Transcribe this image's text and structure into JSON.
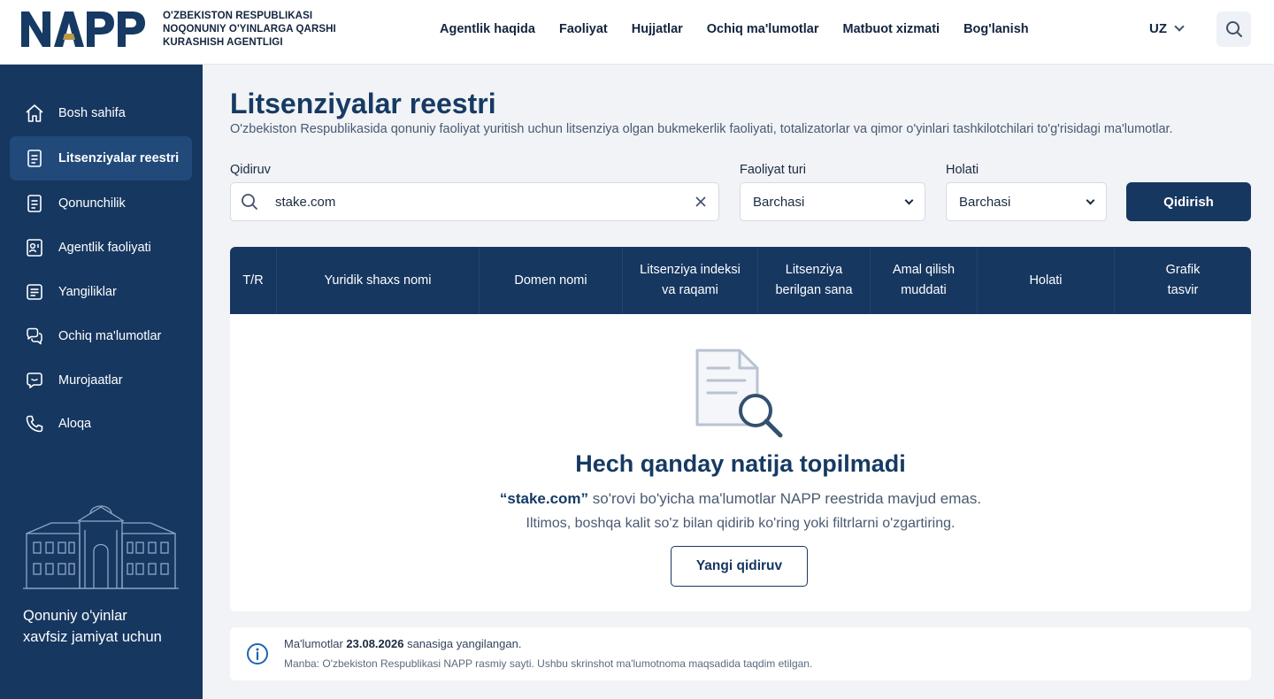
{
  "header": {
    "logo_main": "NAPP",
    "agency_lines": [
      "O'ZBEKISTON RESPUBLIKASI",
      "NOQONUNIY O'YINLARGA QARSHI",
      "KURASHISH AGENTLIGI"
    ],
    "nav": [
      "Agentlik haqida",
      "Faoliyat",
      "Hujjatlar",
      "Ochiq ma'lumotlar",
      "Matbuot xizmati",
      "Bog'lanish"
    ],
    "lang": "UZ",
    "search_icon": "search-icon"
  },
  "sidebar": {
    "items": [
      {
        "label": "Bosh sahifa",
        "icon": "home-icon"
      },
      {
        "label": "Litsenziyalar reestri",
        "icon": "document-icon"
      },
      {
        "label": "Qonunchilik",
        "icon": "document-icon"
      },
      {
        "label": "Agentlik faoliyati",
        "icon": "chart-user-icon"
      },
      {
        "label": "Yangiliklar",
        "icon": "news-icon"
      },
      {
        "label": "Ochiq ma'lumotlar",
        "icon": "chat-icon"
      },
      {
        "label": "Murojaatlar",
        "icon": "message-icon"
      },
      {
        "label": "Aloqa",
        "icon": "phone-icon"
      }
    ],
    "active_index": 1,
    "slogan_line1": "Qonuniy o'yinlar",
    "slogan_line2": "xavfsiz jamiyat uchun"
  },
  "main": {
    "title": "Litsenziyalar reestri",
    "subtitle": "O'zbekiston Respublikasida qonuniy faoliyat yuritish uchun litsenziya olgan bukmekerlik faoliyati, totalizatorlar va qimor o'yinlari tashkilotchilari to'g'risidagi ma'lumotlar.",
    "filters": {
      "search_label": "Qidiruv",
      "search_value": "stake.com",
      "type_label": "Faoliyat turi",
      "type_value": "Barchasi",
      "status_label": "Holati",
      "status_value": "Barchasi",
      "submit": "Qidirish"
    },
    "table": {
      "columns": [
        [
          "T/R"
        ],
        [
          "Yuridik shaxs nomi"
        ],
        [
          "Domen nomi"
        ],
        [
          "Litsenziya indeksi",
          "va raqami"
        ],
        [
          "Litsenziya",
          "berilgan sana"
        ],
        [
          "Amal qilish",
          "muddati"
        ],
        [
          "Holati"
        ],
        [
          "Grafik",
          "tasvir"
        ]
      ]
    },
    "empty": {
      "title": "Hech qanday natija topilmadi",
      "query": "“stake.com”",
      "line1_rest": " so'rovi bo'yicha ma'lumotlar NAPP reestrida mavjud emas.",
      "line2": "Iltimos, boshqa kalit so'z bilan qidirib ko'ring yoki filtrlarni o'zgartiring.",
      "button": "Yangi qidiruv"
    },
    "info": {
      "prefix": "Ma'lumotlar ",
      "date": "23.08.2026",
      "suffix": " sanasiga yangilangan.",
      "source": "Manba: O'zbekiston Respublikasi NAPP rasmiy sayti. Ushbu skrinshot ma'lumotnoma maqsadida taqdim etilgan."
    }
  },
  "colors": {
    "primary": "#163760",
    "accent_gold": "#b99a4a",
    "bg": "#f1f3f6"
  }
}
